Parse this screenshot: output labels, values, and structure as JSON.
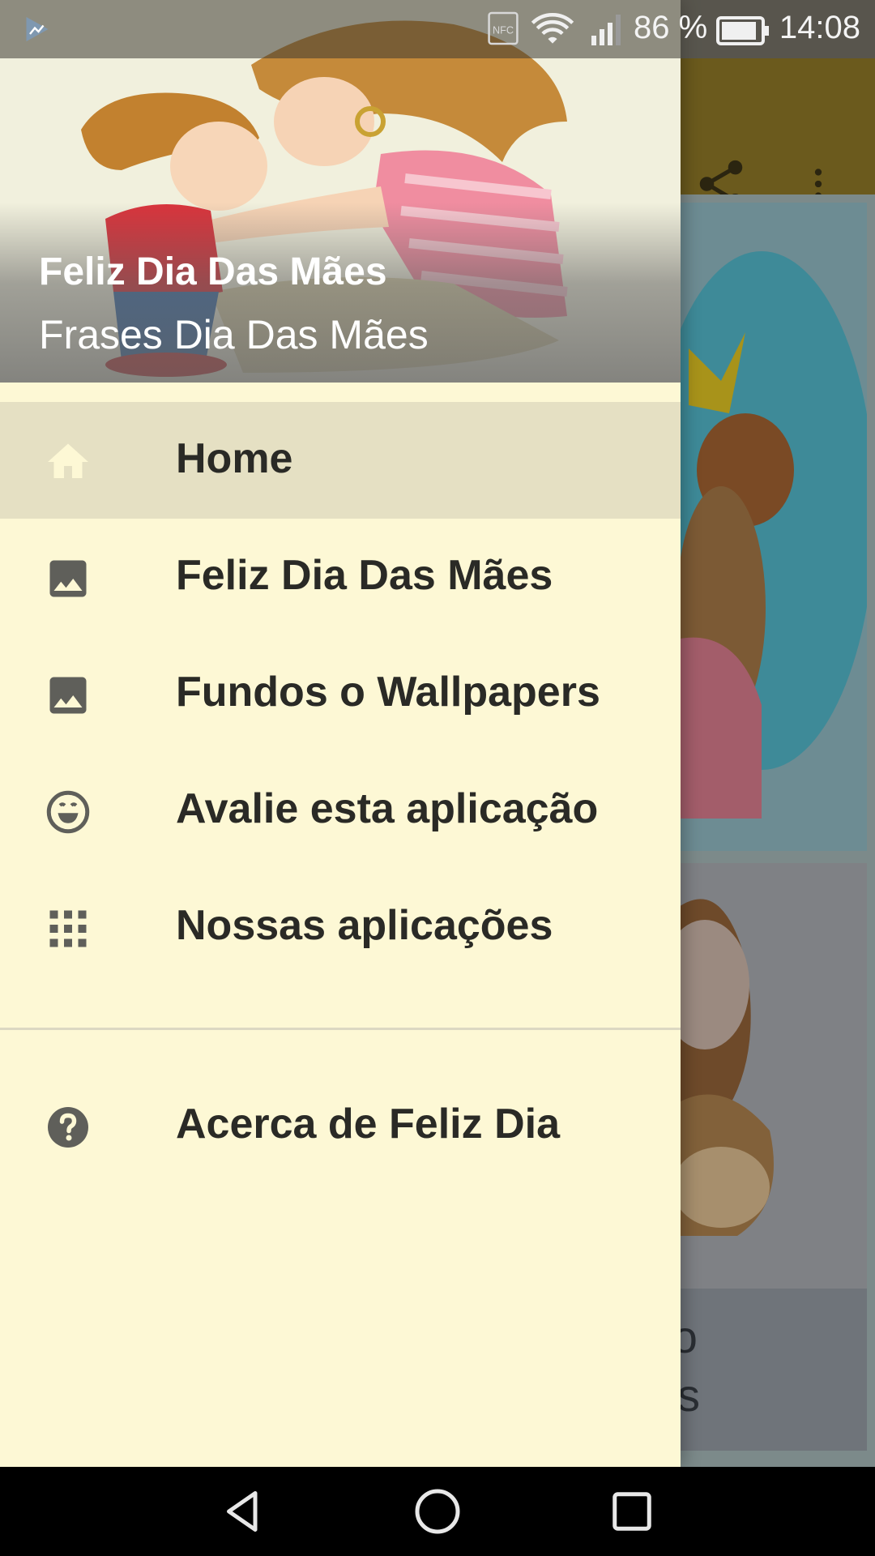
{
  "status_bar": {
    "battery_percent": "86 %",
    "time": "14:08",
    "icons": [
      "play-store-notification-icon",
      "nfc-icon",
      "wifi-icon",
      "signal-icon",
      "battery-icon"
    ]
  },
  "drawer": {
    "title": "Feliz Dia Das Mães",
    "subtitle": "Frases Dia Das Mães",
    "items": [
      {
        "label": "Home",
        "icon": "home-icon",
        "selected": true
      },
      {
        "label": "Feliz Dia Das Mães",
        "icon": "image-icon",
        "selected": false
      },
      {
        "label": "Fundos o Wallpapers",
        "icon": "image-icon",
        "selected": false
      },
      {
        "label": "Avalie esta aplicação",
        "icon": "smiley-icon",
        "selected": false
      },
      {
        "label": "Nossas aplicações",
        "icon": "apps-grid-icon",
        "selected": false
      }
    ],
    "secondary_items": [
      {
        "label": "Acerca de Feliz Dia",
        "icon": "help-icon"
      }
    ]
  },
  "background": {
    "toolbar_icons": [
      "share-icon",
      "more-vert-icon"
    ],
    "card_caption": "os o\npers"
  },
  "nav_bar": {
    "icons": [
      "back-icon",
      "home-circle-icon",
      "recents-icon"
    ]
  },
  "colors": {
    "drawer_bg": "#fdf8d5",
    "selected_bg": "#e5e0c3",
    "label_text": "#2a2a26",
    "icon_gray": "#5f5f5a",
    "home_icon": "#fdf8d5",
    "toolbar_dimmed": "#6b5a1d"
  }
}
